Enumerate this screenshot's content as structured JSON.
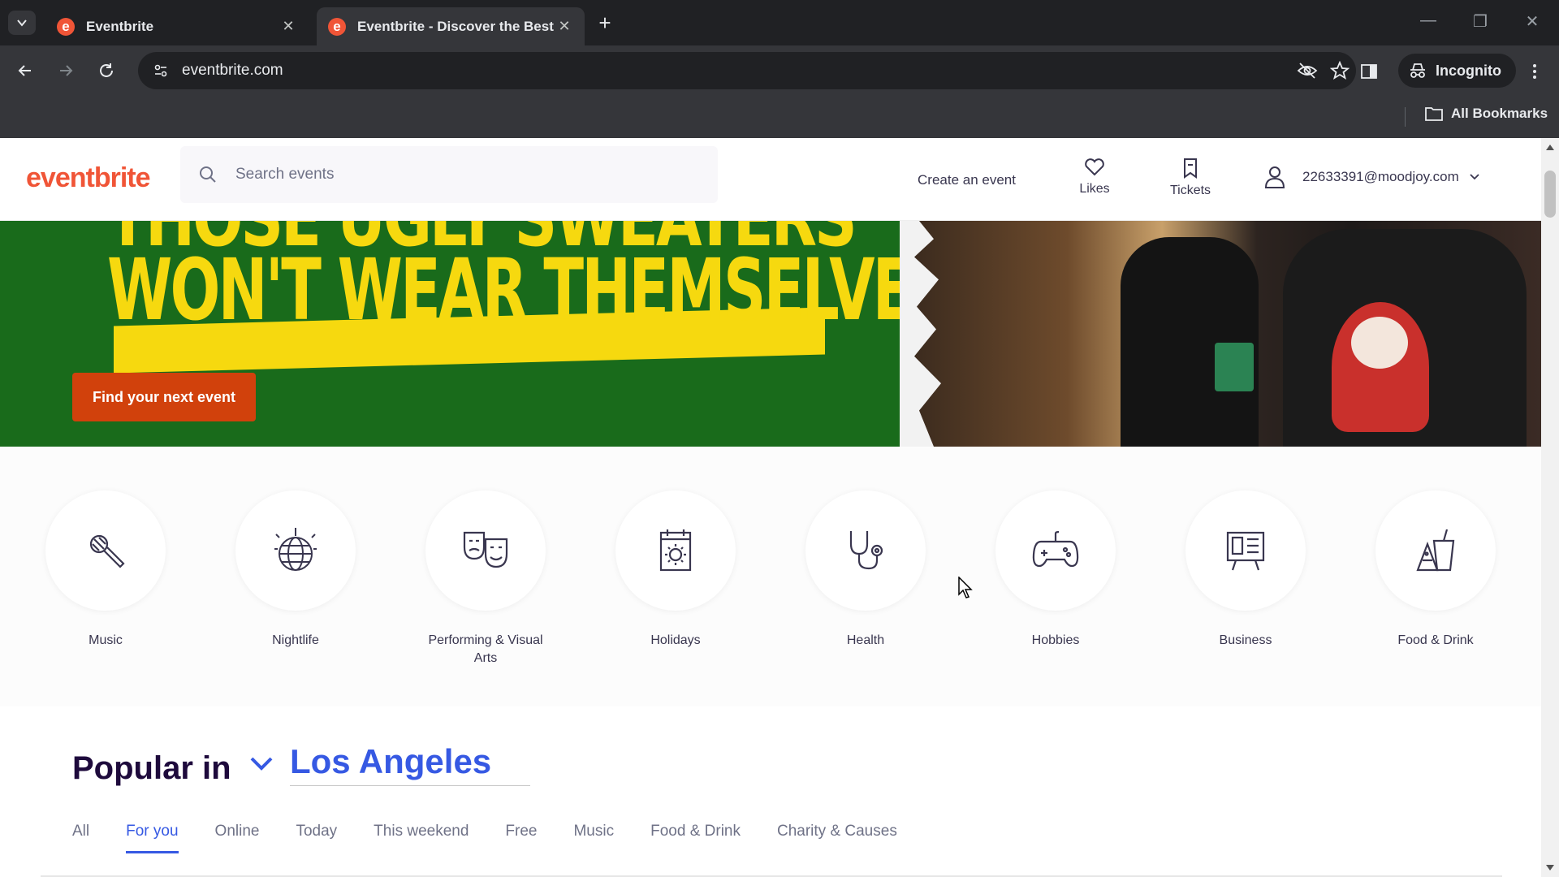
{
  "browser": {
    "tabs": [
      {
        "title": "Eventbrite",
        "favicon": "e"
      },
      {
        "title": "Eventbrite - Discover the Best L",
        "favicon": "e"
      }
    ],
    "url": "eventbrite.com",
    "incognito_label": "Incognito",
    "bookmarks_label": "All Bookmarks"
  },
  "header": {
    "logo": "eventbrite",
    "search_placeholder": "Search events",
    "create_event": "Create an event",
    "likes": "Likes",
    "tickets": "Tickets",
    "account_email": "22633391@moodjoy.com"
  },
  "hero": {
    "headline_line1": "THOSE UGLY SWEATERS",
    "headline_line2": "WON'T WEAR THEMSELVES",
    "cta": "Find your next event"
  },
  "categories": [
    {
      "label": "Music",
      "icon": "microphone-icon"
    },
    {
      "label": "Nightlife",
      "icon": "disco-ball-icon"
    },
    {
      "label": "Performing & Visual Arts",
      "icon": "theater-masks-icon"
    },
    {
      "label": "Holidays",
      "icon": "calendar-icon"
    },
    {
      "label": "Health",
      "icon": "stethoscope-icon"
    },
    {
      "label": "Hobbies",
      "icon": "gamepad-icon"
    },
    {
      "label": "Business",
      "icon": "presentation-board-icon"
    },
    {
      "label": "Food & Drink",
      "icon": "food-drink-icon"
    }
  ],
  "popular": {
    "title": "Popular in",
    "city": "Los Angeles",
    "filters": [
      "All",
      "For you",
      "Online",
      "Today",
      "This weekend",
      "Free",
      "Music",
      "Food & Drink",
      "Charity & Causes"
    ],
    "active_filter": "For you"
  },
  "colors": {
    "brand": "#f05537",
    "cta": "#d1410c",
    "link_blue": "#3659e3",
    "hero_green": "#196b1b",
    "hero_yellow": "#f6d90f"
  }
}
